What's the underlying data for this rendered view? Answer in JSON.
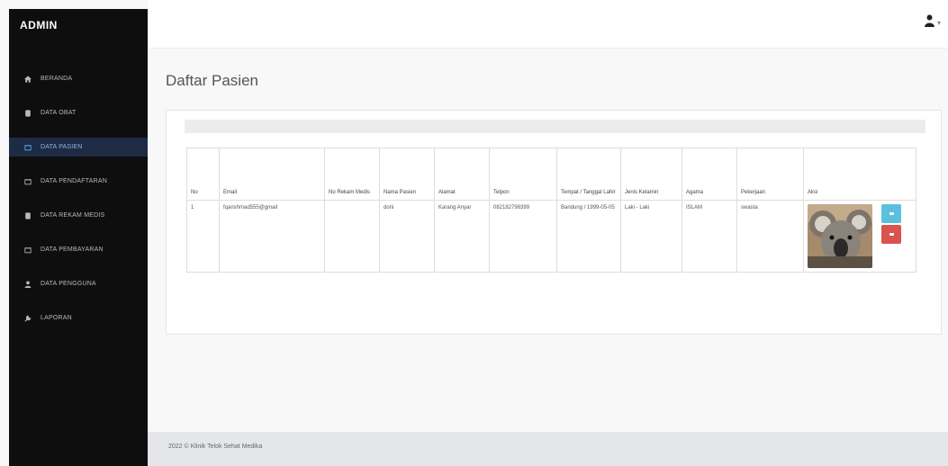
{
  "app": {
    "brand": "ADMIN"
  },
  "sidebar": {
    "items": [
      {
        "label": "BERANDA",
        "icon": "home-icon",
        "active": false
      },
      {
        "label": "DATA OBAT",
        "icon": "pill-icon",
        "active": false
      },
      {
        "label": "DATA PASIEN",
        "icon": "folder-icon",
        "active": true
      },
      {
        "label": "DATA PENDAFTARAN",
        "icon": "folder-icon",
        "active": false
      },
      {
        "label": "DATA REKAM MEDIS",
        "icon": "pill-icon",
        "active": false
      },
      {
        "label": "DATA PEMBAYARAN",
        "icon": "folder-icon",
        "active": false
      },
      {
        "label": "DATA PENGGUNA",
        "icon": "user-icon",
        "active": false
      },
      {
        "label": "LAPORAN",
        "icon": "wrench-icon",
        "active": false
      }
    ]
  },
  "header": {
    "user_icon": "user-icon",
    "caret": "▾"
  },
  "main": {
    "title": "Daftar Pasien",
    "table": {
      "columns": [
        "No",
        "Email",
        "No Rekam Medis",
        "Nama Pasien",
        "Alamat",
        "Telpon",
        "Tempat / Tanggal Lahir",
        "Jenis Kelamin",
        "Agama",
        "Pekerjaan",
        "Aksi"
      ],
      "rows": [
        {
          "no": "1",
          "email": "fqanshmad555@gmail",
          "rekam_medis": "",
          "nama": "doni",
          "alamat": "Karang Anyar",
          "telpon": "082182798399",
          "ttl": "Bandung / 1999-05-05",
          "jenis_kelamin": "Laki - Laki",
          "agama": "ISLAM",
          "pekerjaan": "swasta"
        }
      ]
    }
  },
  "footer": {
    "text": "2022 © Klinik Telok Sehat Medika"
  },
  "colors": {
    "sidebar_bg": "#0e0e0e",
    "active_item_bg": "#1d2c44",
    "info": "#5bc0de",
    "danger": "#d9534f"
  }
}
